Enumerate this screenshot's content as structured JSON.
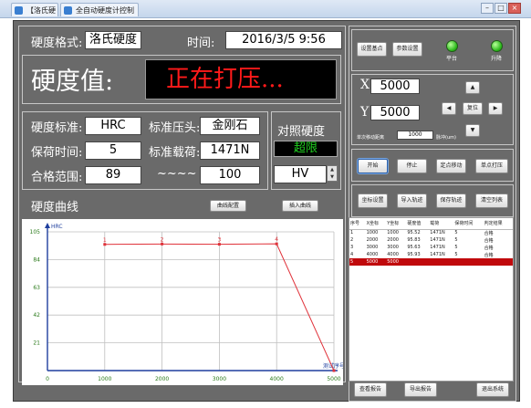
{
  "window": {
    "tabs": [
      {
        "label": "【洛氏硬度】"
      },
      {
        "label": "全自动硬度计控制软件"
      }
    ]
  },
  "header": {
    "mode_label": "硬度格式:",
    "mode_value": "洛氏硬度",
    "time_label": "时间:",
    "time_value": "2016/3/5  9:56"
  },
  "hardness": {
    "label": "硬度值:",
    "value": "正在打压..."
  },
  "params": {
    "standard_label": "硬度标准:",
    "standard_value": "HRC",
    "indenter_label": "标准压头:",
    "indenter_value": "金刚石",
    "hold_label": "保荷时间:",
    "hold_value": "5",
    "load_label": "标准载荷:",
    "load_value": "1471N",
    "range_label": "合格范围:",
    "range_min": "89",
    "range_sep": "~~~~",
    "range_max": "100"
  },
  "compare": {
    "title": "对照硬度",
    "status": "超限",
    "scale_value": "HV"
  },
  "curve": {
    "title": "硬度曲线",
    "settings_button": "曲线配置",
    "insert_button": "插入曲线"
  },
  "chart_data": {
    "type": "line",
    "ylabel": "HRC",
    "xlabel": "测试序号",
    "xlim": [
      0,
      5000
    ],
    "ylim": [
      0,
      105
    ],
    "xticks": [
      "0",
      "1000",
      "2000",
      "3000",
      "4000",
      "5000"
    ],
    "yticks": [
      "105",
      "84",
      "63",
      "42",
      "21"
    ],
    "grid": true,
    "series": [
      {
        "x": [
          1000,
          2000,
          3000,
          4000,
          5000
        ],
        "y": [
          95.5,
          95.8,
          95.6,
          95.9,
          0
        ],
        "labels": [
          "1",
          "2",
          "3",
          "4",
          ""
        ]
      }
    ],
    "colors": {
      "line": "#e0323a",
      "grid": "#bfbfbf",
      "axis": "#1f3f9e"
    }
  },
  "indicators": {
    "set_points_button": "设置基点",
    "param_settings_button": "参数设置",
    "led1_label": "平台",
    "led2_label": "升降"
  },
  "position": {
    "x_label": "X",
    "x_value": "5000",
    "y_label": "Y",
    "y_value": "5000",
    "step_label": "单次移动距离",
    "step_value": "1000",
    "step_unit": "脉冲(um)",
    "up_icon": "▲",
    "down_icon": "▼",
    "left_icon": "◀",
    "right_icon": "▶",
    "reset_button": "复位"
  },
  "control_buttons": {
    "start": "开始",
    "stop": "停止",
    "move": "定点移动",
    "single": "单点打压",
    "save_settings": "坐标设置",
    "import": "导入轨迹",
    "save_track": "保存轨迹",
    "clear_list": "清空列表"
  },
  "result_table": {
    "columns": [
      "序号",
      "X坐标",
      "Y坐标",
      "硬度值",
      "载荷",
      "保荷时间",
      "判定结果"
    ],
    "rows": [
      [
        "1",
        "1000",
        "1000",
        "95.52",
        "1471N",
        "5",
        "合格"
      ],
      [
        "2",
        "2000",
        "2000",
        "95.83",
        "1471N",
        "5",
        "合格"
      ],
      [
        "3",
        "3000",
        "3000",
        "95.63",
        "1471N",
        "5",
        "合格"
      ],
      [
        "4",
        "4000",
        "4000",
        "95.93",
        "1471N",
        "5",
        "合格"
      ],
      [
        "5",
        "5000",
        "5000",
        "",
        "",
        "",
        ""
      ]
    ],
    "selected_row": 4
  },
  "footer": {
    "report_button": "查看报告",
    "save_report_button": "导出报告",
    "exit_button": "退出系统"
  }
}
